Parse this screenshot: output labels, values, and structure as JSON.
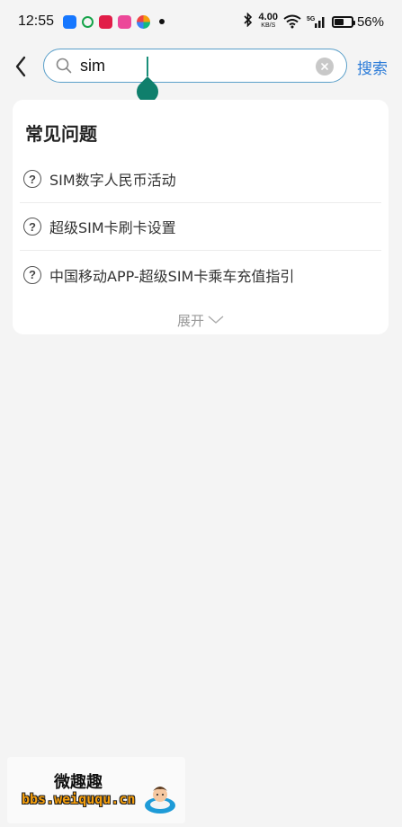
{
  "status_bar": {
    "time": "12:55",
    "net_speed_value": "4.00",
    "net_speed_unit": "KB/S",
    "battery_percent": "56%",
    "battery_level": 0.56
  },
  "search": {
    "value": "sim",
    "button_label": "搜索"
  },
  "faq": {
    "title": "常见问题",
    "items": [
      {
        "label": "SIM数字人民币活动"
      },
      {
        "label": "超级SIM卡刷卡设置"
      },
      {
        "label": "中国移动APP-超级SIM卡乘车充值指引"
      }
    ],
    "expand_label": "展开"
  },
  "watermark": {
    "title": "微趣趣",
    "url": "bbs.weiququ.cn"
  },
  "colors": {
    "accent": "#2b7bd8",
    "search_border": "#5a9fc9",
    "caret": "#0f7f6c",
    "background": "#f4f4f4"
  }
}
